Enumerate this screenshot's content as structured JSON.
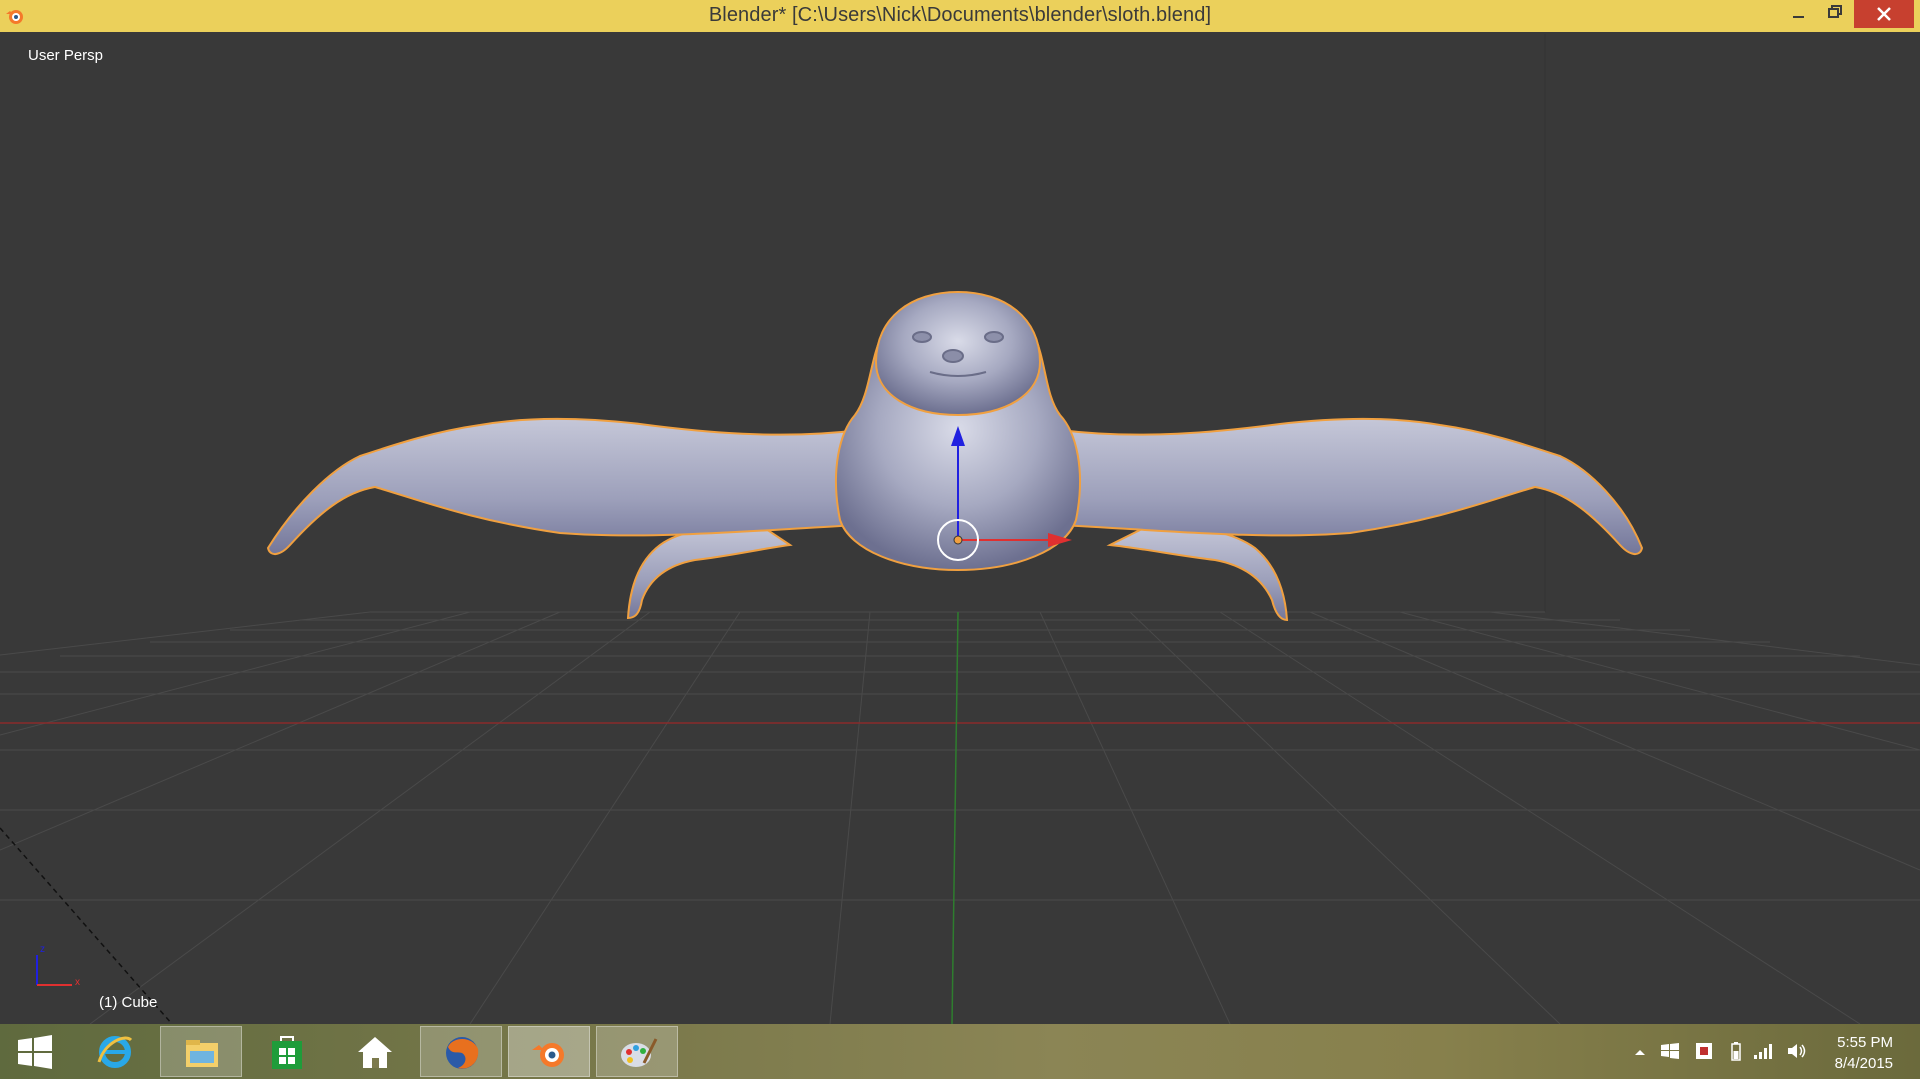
{
  "window": {
    "title": "Blender* [C:\\Users\\Nick\\Documents\\blender\\sloth.blend]",
    "controls": [
      "minimize",
      "restore",
      "close"
    ]
  },
  "viewport": {
    "view_label": "User Persp",
    "object_label": "(1) Cube",
    "axis_labels": {
      "z": "z",
      "x": "x"
    }
  },
  "taskbar": {
    "apps": [
      {
        "name": "start-icon"
      },
      {
        "name": "internet-explorer-icon"
      },
      {
        "name": "file-explorer-icon"
      },
      {
        "name": "store-icon"
      },
      {
        "name": "home-icon"
      },
      {
        "name": "firefox-icon"
      },
      {
        "name": "blender-icon",
        "active": true
      },
      {
        "name": "paint-icon"
      }
    ],
    "clock": {
      "time": "5:55 PM",
      "date": "8/4/2015"
    }
  },
  "colors": {
    "titlebar": "#ebd05b",
    "viewport_bg": "#393939",
    "selection_outline": "#f0a040",
    "mesh": "#a3a7c0",
    "x_axis": "#e03030",
    "y_axis": "#30a030",
    "z_axis": "#2020e0",
    "close_button": "#c7402f"
  }
}
